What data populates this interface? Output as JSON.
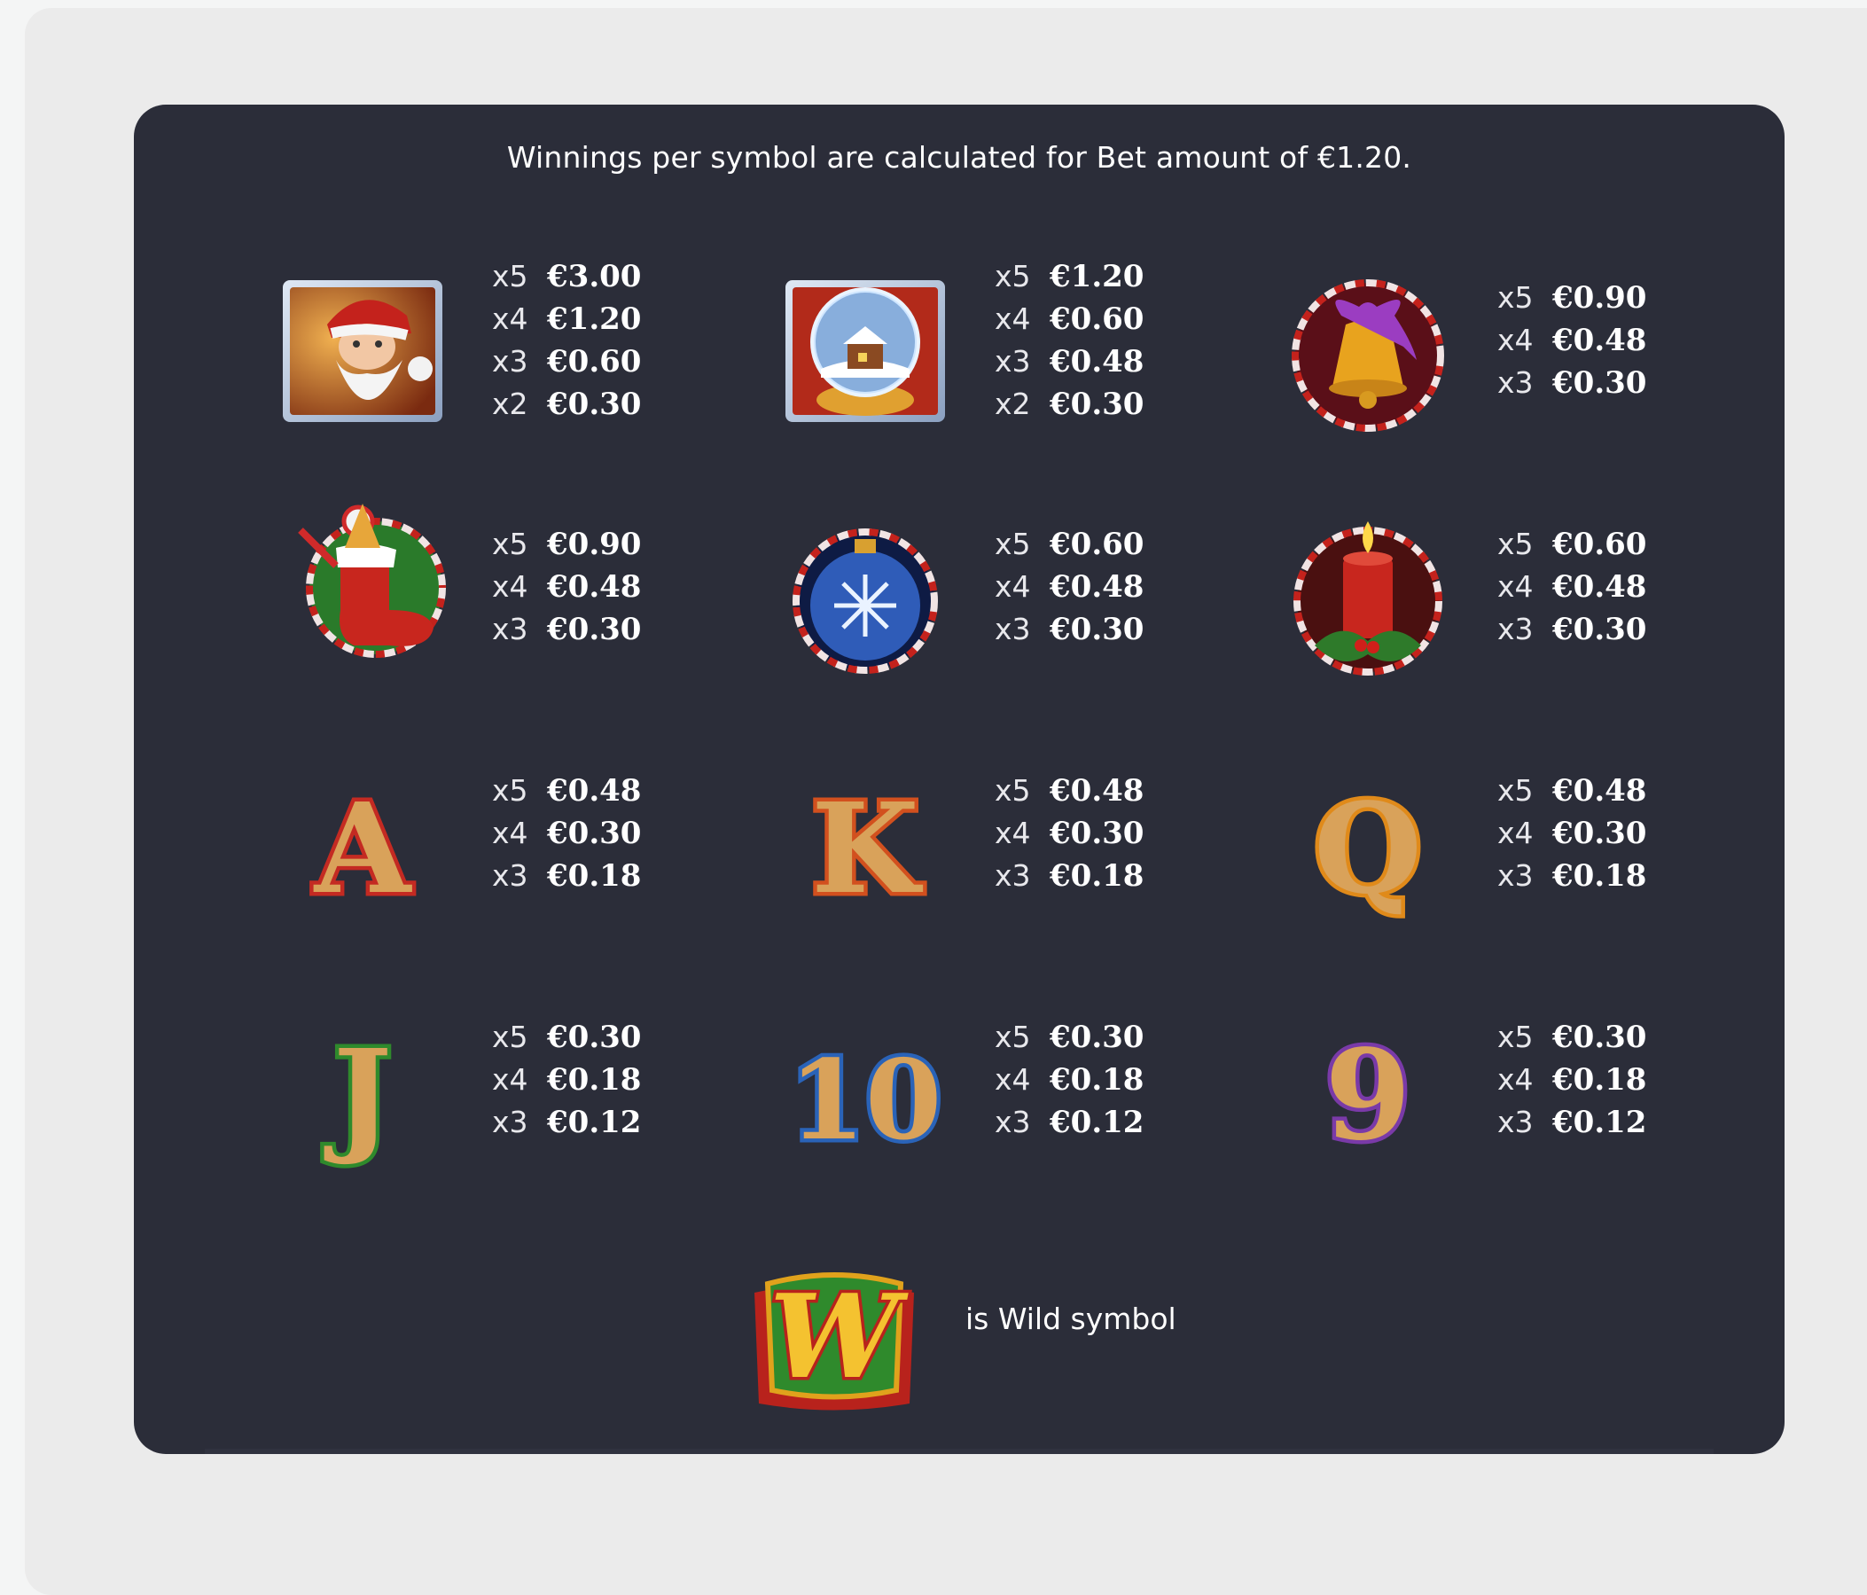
{
  "header": {
    "note": "Winnings per symbol are calculated for Bet amount of €1.20."
  },
  "symbols": [
    {
      "icon": "santa-icon",
      "pays": [
        {
          "mult": "x5",
          "amount": "€3.00"
        },
        {
          "mult": "x4",
          "amount": "€1.20"
        },
        {
          "mult": "x3",
          "amount": "€0.60"
        },
        {
          "mult": "x2",
          "amount": "€0.30"
        }
      ]
    },
    {
      "icon": "snow-globe-icon",
      "pays": [
        {
          "mult": "x5",
          "amount": "€1.20"
        },
        {
          "mult": "x4",
          "amount": "€0.60"
        },
        {
          "mult": "x3",
          "amount": "€0.48"
        },
        {
          "mult": "x2",
          "amount": "€0.30"
        }
      ]
    },
    {
      "icon": "bell-icon",
      "pays": [
        {
          "mult": "x5",
          "amount": "€0.90"
        },
        {
          "mult": "x4",
          "amount": "€0.48"
        },
        {
          "mult": "x3",
          "amount": "€0.30"
        }
      ]
    },
    {
      "icon": "stocking-icon",
      "pays": [
        {
          "mult": "x5",
          "amount": "€0.90"
        },
        {
          "mult": "x4",
          "amount": "€0.48"
        },
        {
          "mult": "x3",
          "amount": "€0.30"
        }
      ]
    },
    {
      "icon": "ornament-icon",
      "pays": [
        {
          "mult": "x5",
          "amount": "€0.60"
        },
        {
          "mult": "x4",
          "amount": "€0.48"
        },
        {
          "mult": "x3",
          "amount": "€0.30"
        }
      ]
    },
    {
      "icon": "candle-icon",
      "pays": [
        {
          "mult": "x5",
          "amount": "€0.60"
        },
        {
          "mult": "x4",
          "amount": "€0.48"
        },
        {
          "mult": "x3",
          "amount": "€0.30"
        }
      ]
    },
    {
      "icon": "letter-a-icon",
      "pays": [
        {
          "mult": "x5",
          "amount": "€0.48"
        },
        {
          "mult": "x4",
          "amount": "€0.30"
        },
        {
          "mult": "x3",
          "amount": "€0.18"
        }
      ]
    },
    {
      "icon": "letter-k-icon",
      "pays": [
        {
          "mult": "x5",
          "amount": "€0.48"
        },
        {
          "mult": "x4",
          "amount": "€0.30"
        },
        {
          "mult": "x3",
          "amount": "€0.18"
        }
      ]
    },
    {
      "icon": "letter-q-icon",
      "pays": [
        {
          "mult": "x5",
          "amount": "€0.48"
        },
        {
          "mult": "x4",
          "amount": "€0.30"
        },
        {
          "mult": "x3",
          "amount": "€0.18"
        }
      ]
    },
    {
      "icon": "letter-j-icon",
      "pays": [
        {
          "mult": "x5",
          "amount": "€0.30"
        },
        {
          "mult": "x4",
          "amount": "€0.18"
        },
        {
          "mult": "x3",
          "amount": "€0.12"
        }
      ]
    },
    {
      "icon": "number-10-icon",
      "pays": [
        {
          "mult": "x5",
          "amount": "€0.30"
        },
        {
          "mult": "x4",
          "amount": "€0.18"
        },
        {
          "mult": "x3",
          "amount": "€0.12"
        }
      ]
    },
    {
      "icon": "number-9-icon",
      "pays": [
        {
          "mult": "x5",
          "amount": "€0.30"
        },
        {
          "mult": "x4",
          "amount": "€0.18"
        },
        {
          "mult": "x3",
          "amount": "€0.12"
        }
      ]
    }
  ],
  "wild": {
    "icon": "wild-w-icon",
    "label": "is Wild symbol"
  },
  "letters": {
    "a": "A",
    "k": "K",
    "q": "Q",
    "j": "J",
    "ten": "10",
    "nine": "9",
    "w": "W"
  },
  "colors": {
    "panel": "#2b2d39",
    "outer": "#ebebeb",
    "text": "#ffffff",
    "cookie": "#d9a25a",
    "red": "#c42a22",
    "green": "#2f8a2c",
    "blue": "#2a63b8",
    "purple": "#7a3aa8",
    "gold": "#e0a21c"
  }
}
